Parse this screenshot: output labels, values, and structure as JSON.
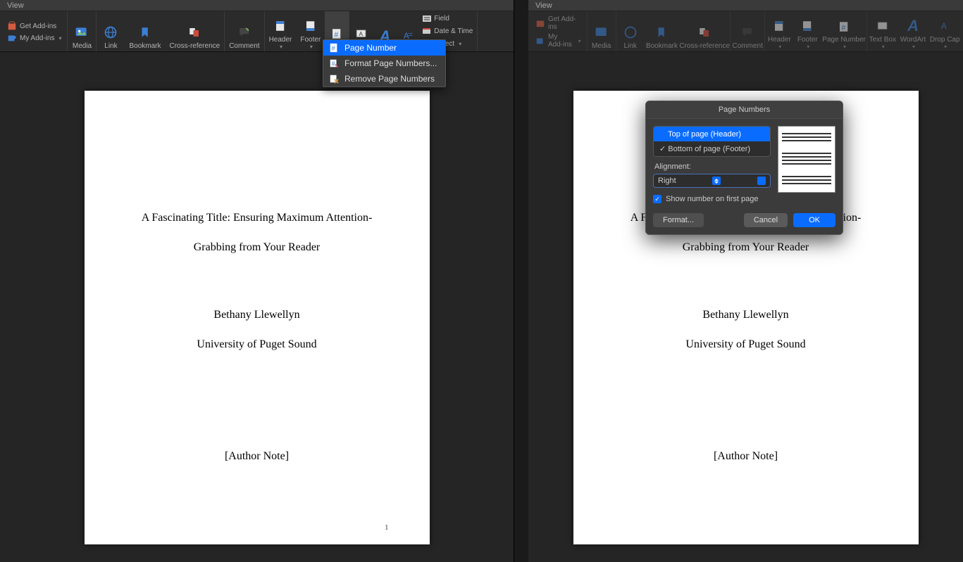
{
  "titlebar": "View",
  "addins": {
    "get": "Get Add-ins",
    "my": "My Add-ins"
  },
  "ribbon_left": {
    "media": "Media",
    "link": "Link",
    "bookmark": "Bookmark",
    "crossref": "Cross-reference",
    "comment": "Comment",
    "header": "Header",
    "footer": "Footer"
  },
  "ribbon_right": {
    "media": "Media",
    "link": "Link",
    "bookmark": "Bookmark",
    "crossref": "Cross-reference",
    "comment": "Comment",
    "header": "Header",
    "footer": "Footer",
    "pagenum": "Page\nNumber",
    "textbox": "Text Box",
    "wordart": "WordArt",
    "dropcap": "Drop\nCap"
  },
  "mini": {
    "field": "Field",
    "datetime": "Date & Time",
    "object": "Object"
  },
  "dropdown": {
    "page_number": "Page Number",
    "format": "Format Page Numbers...",
    "remove": "Remove Page Numbers"
  },
  "doc": {
    "title1": "A Fascinating Title: Ensuring Maximum Attention-",
    "title2": "Grabbing from Your Reader",
    "author": "Bethany Llewellyn",
    "uni": "University of Puget Sound",
    "note": "[Author Note]",
    "pageno": "1"
  },
  "doc_right": {
    "partial1a": "A Fa",
    "partial1b": "ntion-"
  },
  "dialog": {
    "title": "Page Numbers",
    "opt_top": "Top of page (Header)",
    "opt_bottom": "Bottom of page (Footer)",
    "align_label": "Alignment:",
    "align_value": "Right",
    "show_first": "Show number on first page",
    "format": "Format...",
    "cancel": "Cancel",
    "ok": "OK"
  }
}
